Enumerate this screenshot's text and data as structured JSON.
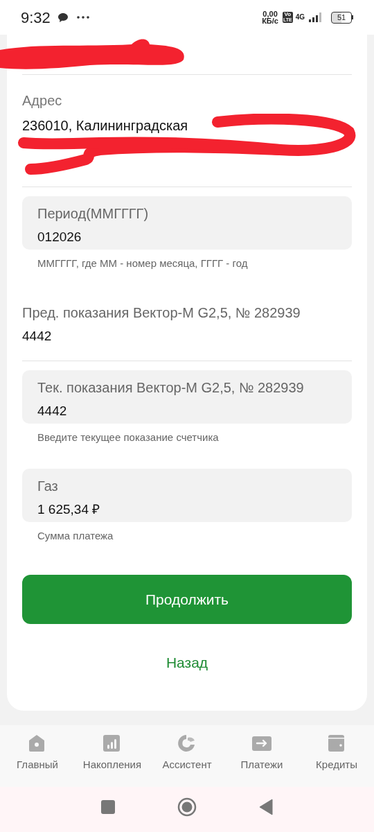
{
  "status_bar": {
    "time": "9:32",
    "speed": "0,00",
    "speed_unit": "КБ/с",
    "volte_top": "Vo",
    "volte_bottom": "LTE",
    "network": "4G",
    "battery": "51"
  },
  "address": {
    "label": "Адрес",
    "value": "236010, Калининградская"
  },
  "fields": [
    {
      "kind": "filled",
      "label": "Период(ММГГГГ)",
      "value": "012026",
      "helper": "ММГГГГ, где ММ - номер месяца, ГГГГ - год"
    },
    {
      "kind": "plain",
      "label": "Пред. показания Вектор-М G2,5, № 282939",
      "value": "4442"
    },
    {
      "kind": "filled",
      "label": "Тек. показания Вектор-М G2,5, № 282939",
      "value": "4442",
      "helper": "Введите текущее показание счетчика"
    },
    {
      "kind": "filled",
      "label": "Газ",
      "value": "1 625,34 ₽",
      "helper": "Сумма платежа"
    }
  ],
  "primary_button": "Продолжить",
  "back_link": "Назад",
  "bottom_nav": [
    {
      "kind": "home",
      "label": "Главный",
      "selected": false
    },
    {
      "kind": "savings",
      "label": "Накопления",
      "selected": false
    },
    {
      "kind": "assistant",
      "label": "Ассистент",
      "selected": false
    },
    {
      "kind": "payments",
      "label": "Платежи",
      "selected": false
    },
    {
      "kind": "credits",
      "label": "Кредиты",
      "selected": false
    }
  ]
}
